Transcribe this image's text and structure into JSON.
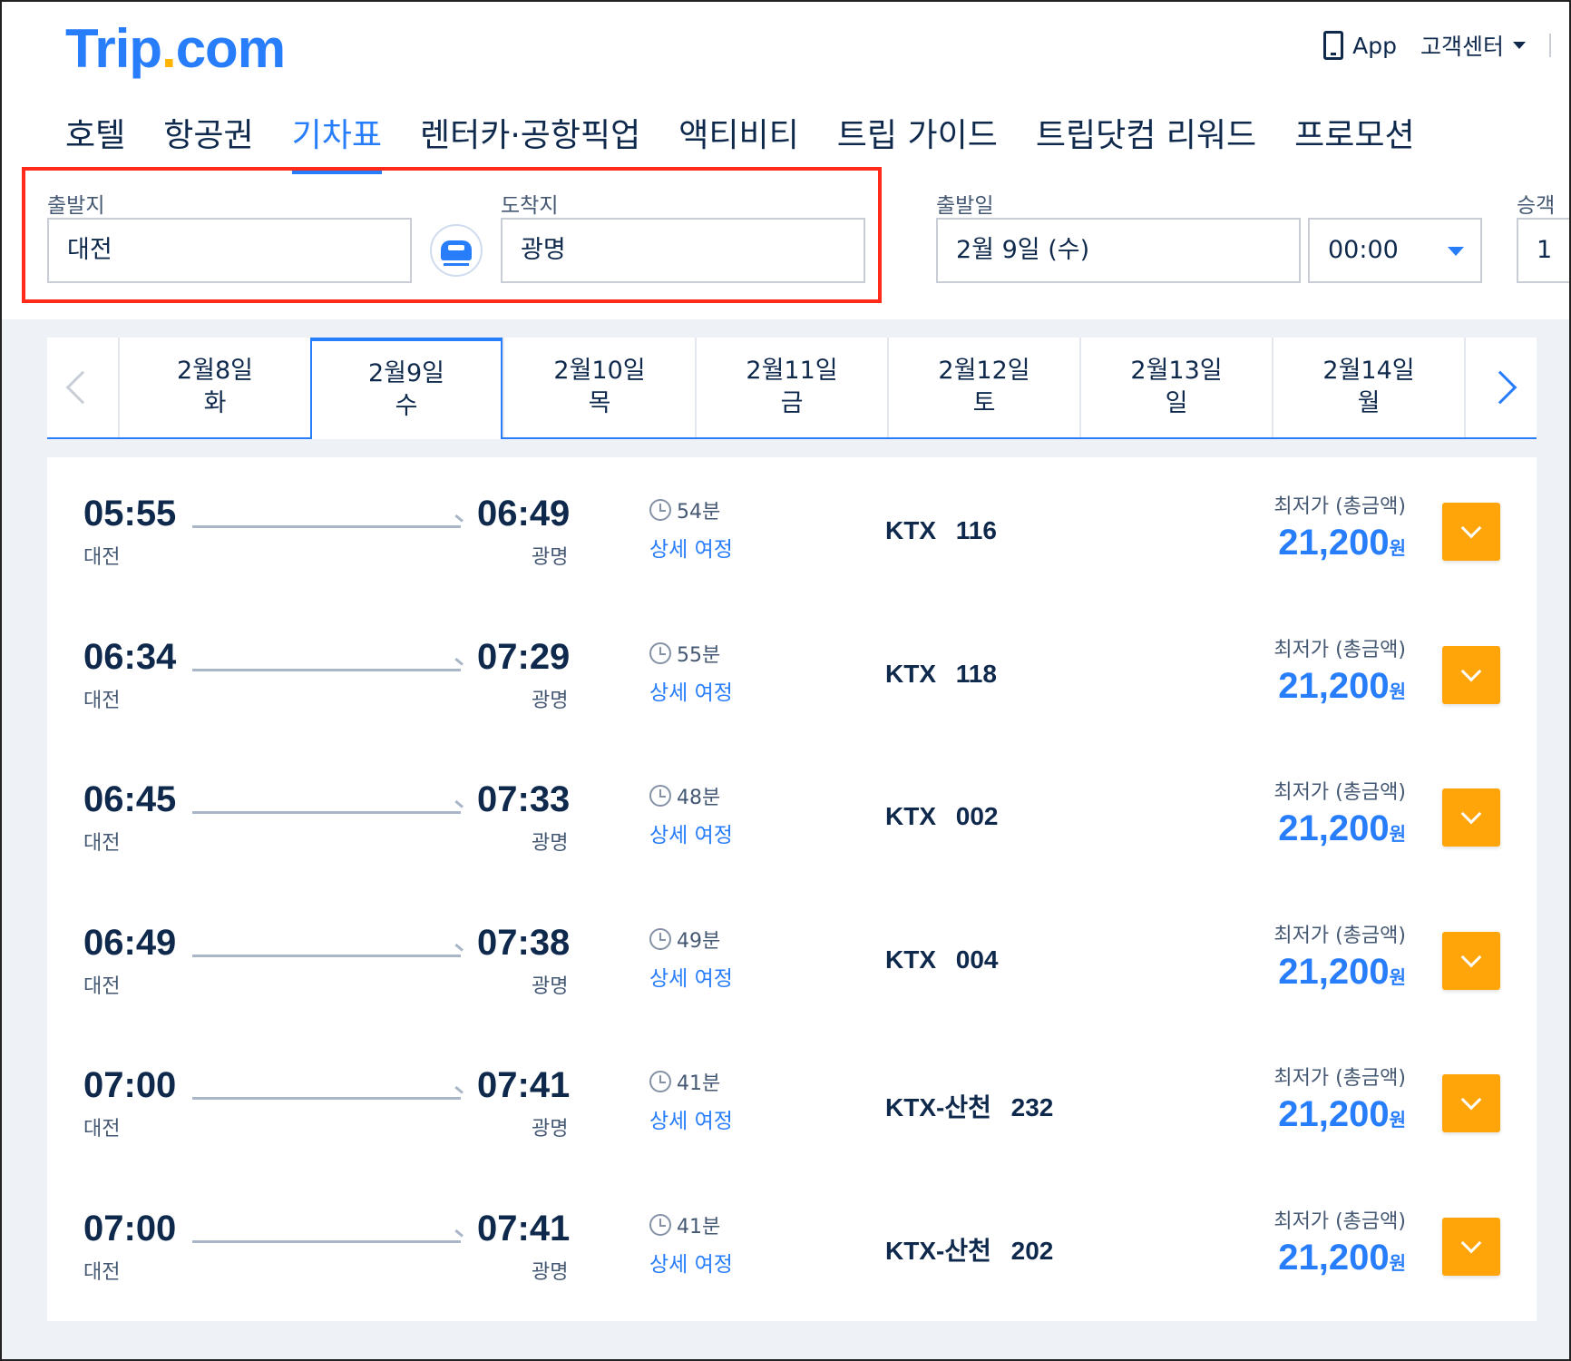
{
  "header": {
    "logo_main": "Trip",
    "logo_dot": ".",
    "logo_suffix": "com",
    "app_label": "App",
    "support_label": "고객센터"
  },
  "nav": [
    {
      "label": "호텔"
    },
    {
      "label": "항공권"
    },
    {
      "label": "기차표",
      "active": true
    },
    {
      "label": "렌터카·공항픽업"
    },
    {
      "label": "액티비티"
    },
    {
      "label": "트립 가이드"
    },
    {
      "label": "트립닷컴 리워드"
    },
    {
      "label": "프로모션"
    }
  ],
  "search": {
    "origin_label": "출발지",
    "origin_value": "대전",
    "destination_label": "도착지",
    "destination_value": "광명",
    "date_label": "출발일",
    "date_value": "2월 9일 (수)",
    "time_value": "00:00",
    "passenger_label": "승객 구",
    "passenger_value": "1"
  },
  "date_tabs": [
    {
      "date": "2월8일",
      "day": "화"
    },
    {
      "date": "2월9일",
      "day": "수",
      "active": true
    },
    {
      "date": "2월10일",
      "day": "목"
    },
    {
      "date": "2월11일",
      "day": "금"
    },
    {
      "date": "2월12일",
      "day": "토"
    },
    {
      "date": "2월13일",
      "day": "일"
    },
    {
      "date": "2월14일",
      "day": "월"
    }
  ],
  "results": {
    "price_label": "최저가 (총금액)",
    "detail_label": "상세 여정",
    "currency": "원",
    "rows": [
      {
        "dep": "05:55",
        "dep_st": "대전",
        "arr": "06:49",
        "arr_st": "광명",
        "dur": "54분",
        "train": "KTX 116",
        "price": "21,200"
      },
      {
        "dep": "06:34",
        "dep_st": "대전",
        "arr": "07:29",
        "arr_st": "광명",
        "dur": "55분",
        "train": "KTX 118",
        "price": "21,200"
      },
      {
        "dep": "06:45",
        "dep_st": "대전",
        "arr": "07:33",
        "arr_st": "광명",
        "dur": "48분",
        "train": "KTX 002",
        "price": "21,200"
      },
      {
        "dep": "06:49",
        "dep_st": "대전",
        "arr": "07:38",
        "arr_st": "광명",
        "dur": "49분",
        "train": "KTX 004",
        "price": "21,200"
      },
      {
        "dep": "07:00",
        "dep_st": "대전",
        "arr": "07:41",
        "arr_st": "광명",
        "dur": "41분",
        "train": "KTX-산천 232",
        "price": "21,200"
      },
      {
        "dep": "07:00",
        "dep_st": "대전",
        "arr": "07:41",
        "arr_st": "광명",
        "dur": "41분",
        "train": "KTX-산천 202",
        "price": "21,200"
      }
    ]
  },
  "colors": {
    "brand_blue": "#287dfa",
    "brand_yellow": "#ffb400",
    "cta_orange": "#ffa50a",
    "highlight_red": "#ff2a1a"
  }
}
